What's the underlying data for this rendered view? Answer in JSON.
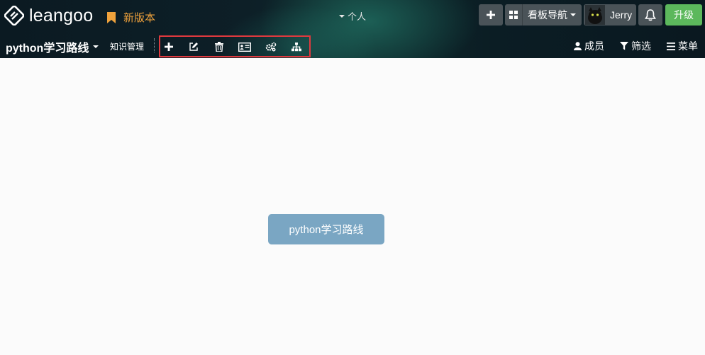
{
  "header": {
    "logo_text": "leangoo",
    "new_version_label": "新版本",
    "personal_label": "个人",
    "boards_nav_label": "看板导航",
    "user_name": "Jerry",
    "upgrade_label": "升级"
  },
  "board": {
    "title": "python学习路线",
    "knowledge_label": "知识管理",
    "members_label": "成员",
    "filter_label": "筛选",
    "menu_label": "菜单"
  },
  "toolbar": {
    "icons": [
      "plus-icon",
      "edit-icon",
      "trash-icon",
      "id-card-icon",
      "cogs-icon",
      "sitemap-icon"
    ]
  },
  "canvas": {
    "root_node_label": "python学习路线"
  },
  "colors": {
    "accent_orange": "#f0a23c",
    "upgrade_green": "#5cb85c",
    "node_blue": "#7aa6c3",
    "highlight_red": "#e0393e"
  }
}
